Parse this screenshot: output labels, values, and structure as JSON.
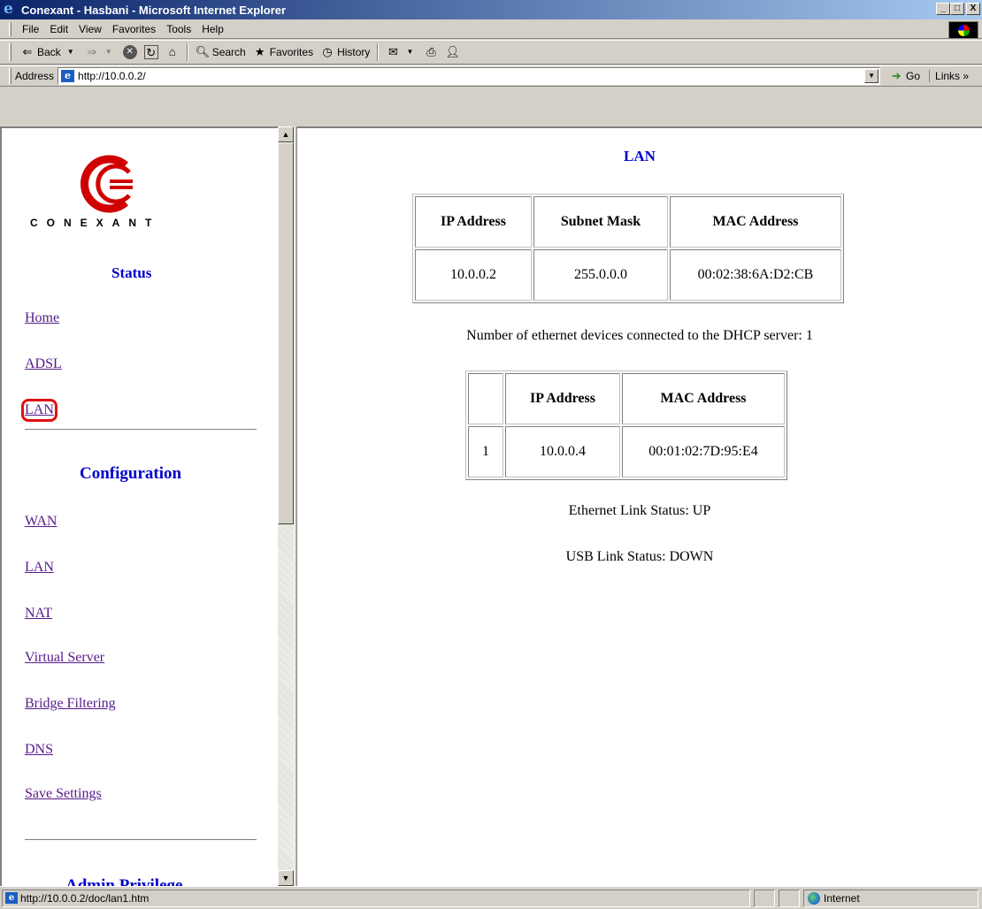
{
  "window": {
    "title": "Conexant - Hasbani - Microsoft Internet Explorer",
    "min_label": "_",
    "max_label": "□",
    "close_label": "X"
  },
  "menu": [
    "File",
    "Edit",
    "View",
    "Favorites",
    "Tools",
    "Help"
  ],
  "toolbar": {
    "back": "Back",
    "search": "Search",
    "favorites": "Favorites",
    "history": "History"
  },
  "address": {
    "label": "Address",
    "url": "http://10.0.0.2/",
    "go": "Go",
    "links": "Links »"
  },
  "sidebar": {
    "logo_text": "CONEXANT",
    "status_title": "Status",
    "status_links": [
      "Home",
      "ADSL",
      "LAN"
    ],
    "active_link": "LAN",
    "config_title": "Configuration",
    "config_links": [
      "WAN",
      "LAN",
      "NAT",
      "Virtual Server",
      "Bridge Filtering",
      "DNS",
      "Save Settings"
    ],
    "admin_title": "Admin Privilege"
  },
  "main": {
    "title": "LAN",
    "lan_table": {
      "headers": [
        "IP Address",
        "Subnet Mask",
        "MAC Address"
      ],
      "row": [
        "10.0.0.2",
        "255.0.0.0",
        "00:02:38:6A:D2:CB"
      ]
    },
    "dhcp_text": "Number of ethernet devices connected to the DHCP server: 1",
    "dhcp_table": {
      "headers": [
        "",
        "IP Address",
        "MAC Address"
      ],
      "row": [
        "1",
        "10.0.0.4",
        "00:01:02:7D:95:E4"
      ]
    },
    "ethernet_status": "Ethernet Link Status: UP",
    "usb_status": "USB Link Status: DOWN"
  },
  "statusbar": {
    "url": "http://10.0.0.2/doc/lan1.htm",
    "zone": "Internet"
  }
}
